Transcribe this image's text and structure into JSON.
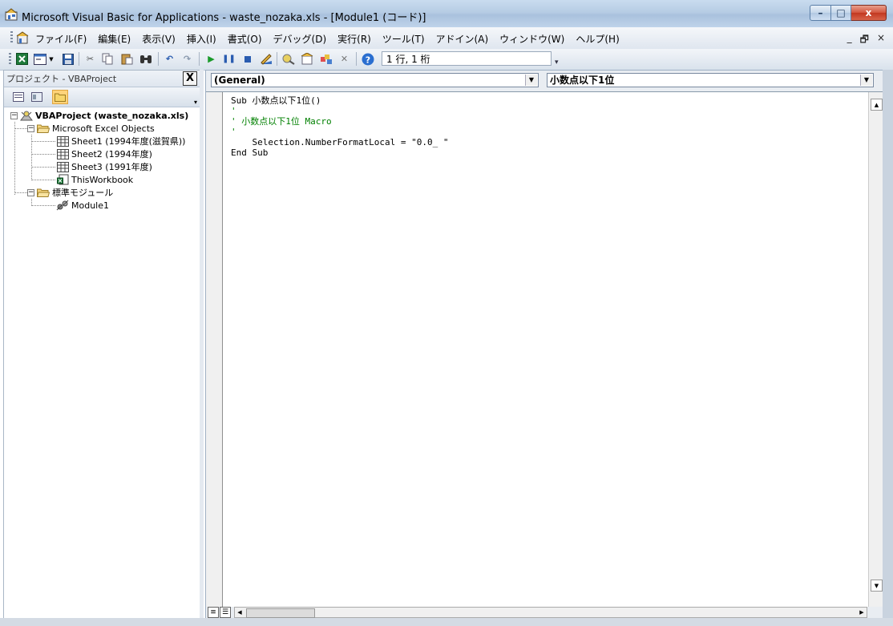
{
  "window": {
    "title": "Microsoft Visual Basic for Applications - waste_nozaka.xls - [Module1 (コード)]",
    "buttons": {
      "minimize": "–",
      "maximize": "□",
      "close": "x"
    }
  },
  "menubar": {
    "items": [
      "ファイル(F)",
      "編集(E)",
      "表示(V)",
      "挿入(I)",
      "書式(O)",
      "デバッグ(D)",
      "実行(R)",
      "ツール(T)",
      "アドイン(A)",
      "ウィンドウ(W)",
      "ヘルプ(H)"
    ],
    "mdi_controls": {
      "minimize": "_",
      "restore": "🗗",
      "close": "×"
    }
  },
  "toolbar": {
    "position_text": "1 行, 1 桁",
    "icons": [
      "excel-icon",
      "userform-icon",
      "save-icon",
      "cut-icon",
      "copy-icon",
      "paste-icon",
      "find-icon",
      "undo-icon",
      "redo-icon",
      "run-icon",
      "break-icon",
      "reset-icon",
      "design-mode-icon",
      "project-explorer-icon",
      "properties-icon",
      "object-browser-icon",
      "toolbox-icon",
      "help-icon"
    ]
  },
  "project_explorer": {
    "title": "プロジェクト - VBAProject",
    "close_label": "X",
    "root": "VBAProject (waste_nozaka.xls)",
    "folder_objects": "Microsoft Excel Objects",
    "sheets": [
      "Sheet1 (1994年度(滋賀県))",
      "Sheet2 (1994年度)",
      "Sheet3 (1991年度)",
      "ThisWorkbook"
    ],
    "folder_modules": "標準モジュール",
    "modules": [
      "Module1"
    ]
  },
  "code_window": {
    "object_combo": "(General)",
    "procedure_combo": "小数点以下1位",
    "lines": [
      {
        "text": "Sub 小数点以下1位()",
        "type": "code"
      },
      {
        "text": "'",
        "type": "comment"
      },
      {
        "text": "' 小数点以下1位 Macro",
        "type": "comment"
      },
      {
        "text": "",
        "type": "code"
      },
      {
        "text": "'",
        "type": "comment"
      },
      {
        "text": "",
        "type": "code"
      },
      {
        "text": "    Selection.NumberFormatLocal = \"0.0_ \"",
        "type": "code"
      },
      {
        "text": "End Sub",
        "type": "code"
      }
    ]
  },
  "colors": {
    "comment": "#008000",
    "code": "#000000",
    "active_tool": "#ffd37a"
  }
}
